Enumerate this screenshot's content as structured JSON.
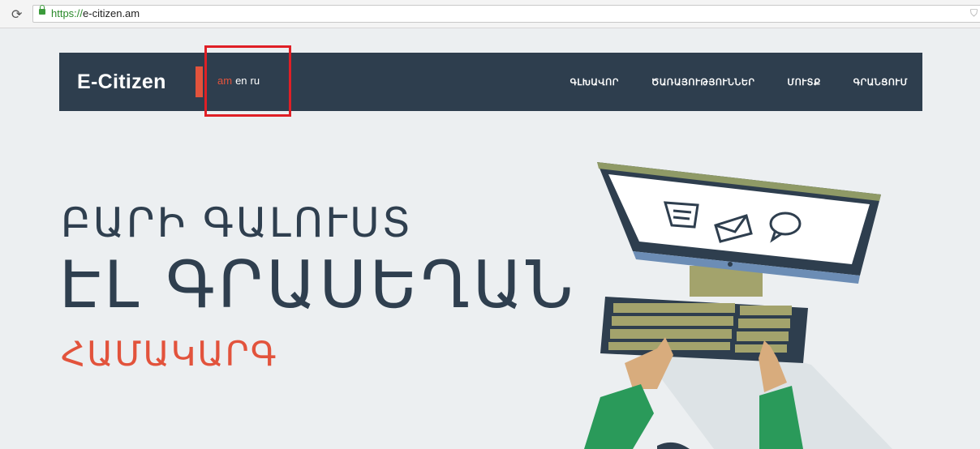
{
  "browser": {
    "url_protocol": "https://",
    "url_host": "e-citizen.am",
    "reload_icon": "reload-icon",
    "lock_icon": "lock-icon"
  },
  "nav": {
    "brand": "E-Citizen",
    "languages": [
      {
        "code": "am",
        "active": true
      },
      {
        "code": "en",
        "active": false
      },
      {
        "code": "ru",
        "active": false
      }
    ],
    "links": [
      "ԳԼԽԱՎՈՐ",
      "ԾԱՌԱՅՈՒԹՅՈՒՆՆԵՐ",
      "ՄՈՒՏՔ",
      "ԳՐԱՆՑՈՒՄ"
    ]
  },
  "hero": {
    "line1": "ԲԱՐԻ ԳԱԼՈՒՍՏ",
    "line2": "ԷԼ ԳՐԱՍԵՂԱՆ",
    "line3": "ՀԱՄԱԿԱՐԳ"
  },
  "colors": {
    "nav_bg": "#2e3e4e",
    "accent": "#e2533c",
    "page_bg": "#eceff1",
    "annotation_box": "#e01f26"
  },
  "illustration": {
    "icons": [
      "document-icon",
      "envelope-icon",
      "chat-bubble-icon"
    ]
  }
}
